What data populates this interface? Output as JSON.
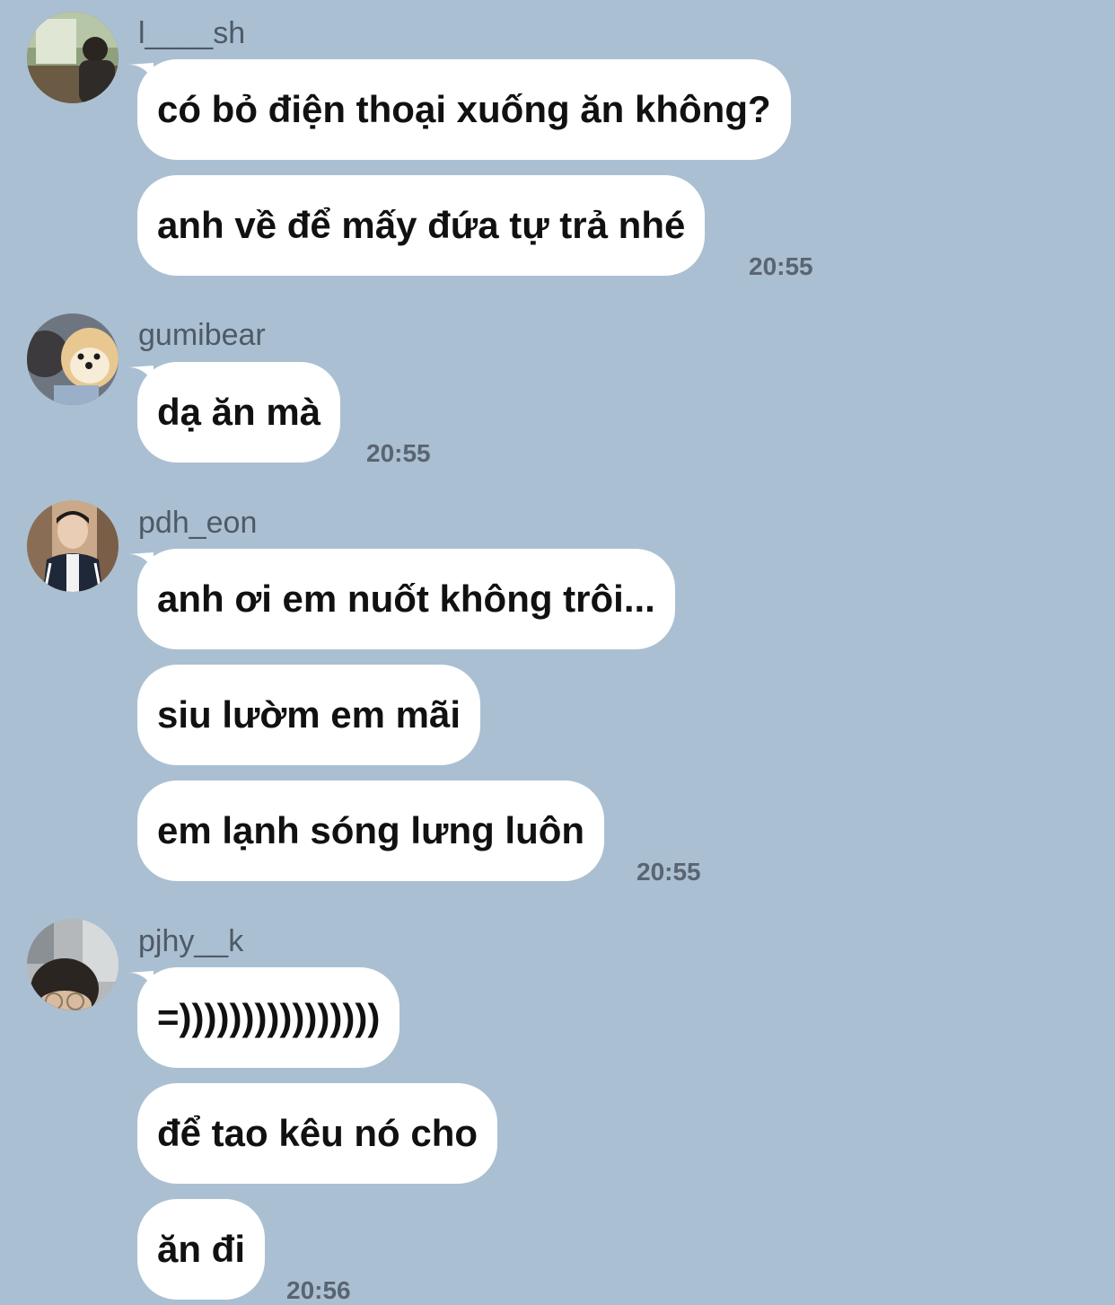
{
  "messages": [
    {
      "user": "l____sh",
      "bubbles": [
        "có bỏ điện thoại xuống ăn không?",
        "anh về để mấy đứa tự trả nhé"
      ],
      "time": "20:55"
    },
    {
      "user": "gumibear",
      "bubbles": [
        "dạ ăn mà"
      ],
      "time": "20:55"
    },
    {
      "user": "pdh_eon",
      "bubbles": [
        "anh ơi em nuốt không trôi...",
        "siu lườm em mãi",
        "em lạnh sóng lưng luôn"
      ],
      "time": "20:55"
    },
    {
      "user": "pjhy__k",
      "bubbles": [
        "=))))))))))))))))",
        "để tao kêu nó cho",
        "ăn đi"
      ],
      "time": "20:56"
    }
  ]
}
